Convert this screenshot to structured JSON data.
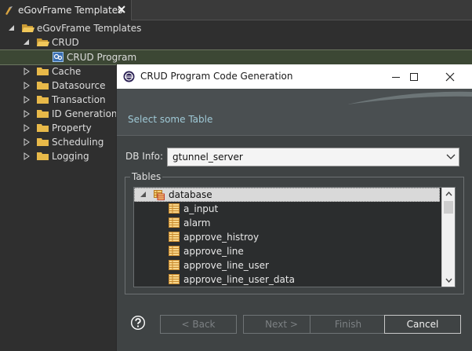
{
  "view": {
    "tab_title": "eGovFrame Templates"
  },
  "tree": {
    "root": "eGovFrame Templates",
    "crud": "CRUD",
    "crud_program": "CRUD Program",
    "folders": [
      "Cache",
      "Datasource",
      "Transaction",
      "ID Generation",
      "Property",
      "Scheduling",
      "Logging"
    ]
  },
  "dialog": {
    "title": "CRUD Program Code Generation",
    "subtitle": "Select some Table",
    "db_info_label": "DB Info:",
    "db_info_value": "gtunnel_server",
    "tables_legend": "Tables",
    "table_root": "database",
    "tables": [
      "a_input",
      "alarm",
      "approve_histroy",
      "approve_line",
      "approve_line_user",
      "approve_line_user_data"
    ],
    "buttons": {
      "back": "< Back",
      "next": "Next >",
      "finish": "Finish",
      "cancel": "Cancel"
    }
  },
  "colors": {
    "background": "#2f2f2f",
    "dialog_bg": "#3f4344",
    "subtitle": "#9fc9d6",
    "folder": "#e8b949",
    "table_icon": "#e8a53c",
    "selection": "#3c4734"
  }
}
